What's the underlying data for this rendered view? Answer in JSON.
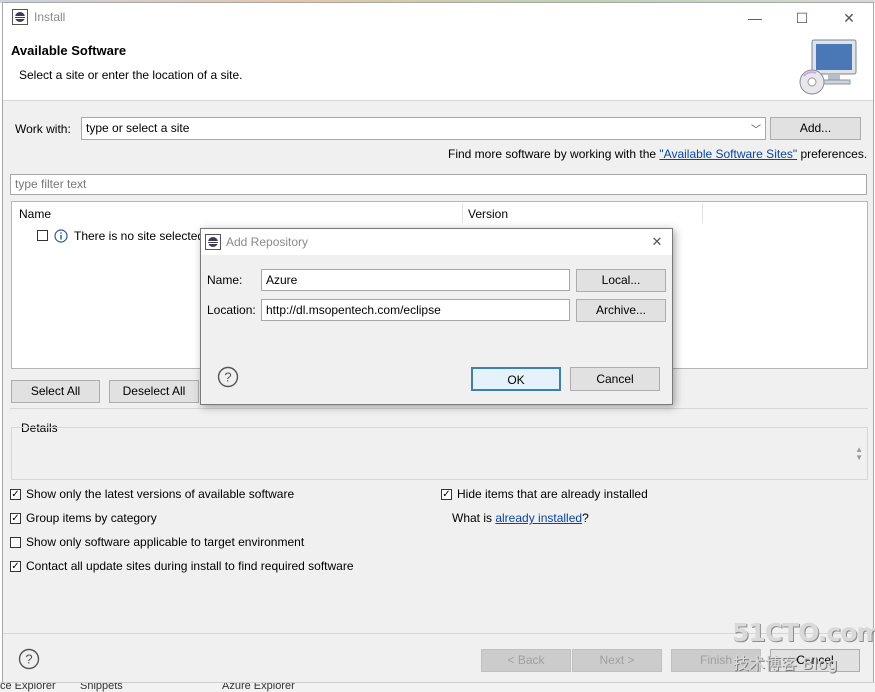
{
  "window": {
    "title": "Install"
  },
  "header": {
    "title": "Available Software",
    "subtitle": "Select a site or enter the location of a site."
  },
  "work_with": {
    "label": "Work with:",
    "value": "type or select a site",
    "add_label": "Add...",
    "find_more_prefix": "Find more software by working with the ",
    "find_more_link": "\"Available Software Sites\"",
    "find_more_suffix": " preferences."
  },
  "filter": {
    "placeholder": "type filter text"
  },
  "table": {
    "columns": [
      "Name",
      "Version"
    ],
    "rows": [
      {
        "name": "There is no site selected."
      }
    ]
  },
  "buttons": {
    "select_all": "Select All",
    "deselect_all": "Deselect All"
  },
  "details": {
    "label": "Details"
  },
  "options": {
    "left": [
      {
        "label": "Show only the latest versions of available software",
        "checked": true
      },
      {
        "label": "Group items by category",
        "checked": true
      },
      {
        "label": "Show only software applicable to target environment",
        "checked": false
      },
      {
        "label": "Contact all update sites during install to find required software",
        "checked": true
      }
    ],
    "hide_installed": {
      "label": "Hide items that are already installed",
      "checked": true
    },
    "what_is_prefix": "What is ",
    "what_is_link": "already installed",
    "what_is_suffix": "?"
  },
  "nav": {
    "back": "< Back",
    "next": "Next >",
    "finish": "Finish",
    "cancel": "Cancel"
  },
  "dialog": {
    "title": "Add Repository",
    "name_label": "Name:",
    "name_value": "Azure",
    "location_label": "Location:",
    "location_value": "http://dl.msopentech.com/eclipse",
    "local_button": "Local...",
    "archive_button": "Archive...",
    "ok_button": "OK",
    "cancel_button": "Cancel"
  },
  "taskbar": {
    "items": [
      "ce Explorer",
      "Snippets",
      "Azure Explorer"
    ]
  },
  "watermark": {
    "line1": "51CTO.com",
    "line2": "技术博客 Blog"
  },
  "colors": {
    "link": "#0645ad",
    "ok_border": "#3c7fb1",
    "dialog_bg": "#f0f0f0"
  },
  "icons": [
    "eclipse-icon",
    "minimize-icon",
    "maximize-icon",
    "close-icon",
    "computer-cd-icon",
    "dropdown-arrow-icon",
    "info-icon",
    "help-icon"
  ]
}
